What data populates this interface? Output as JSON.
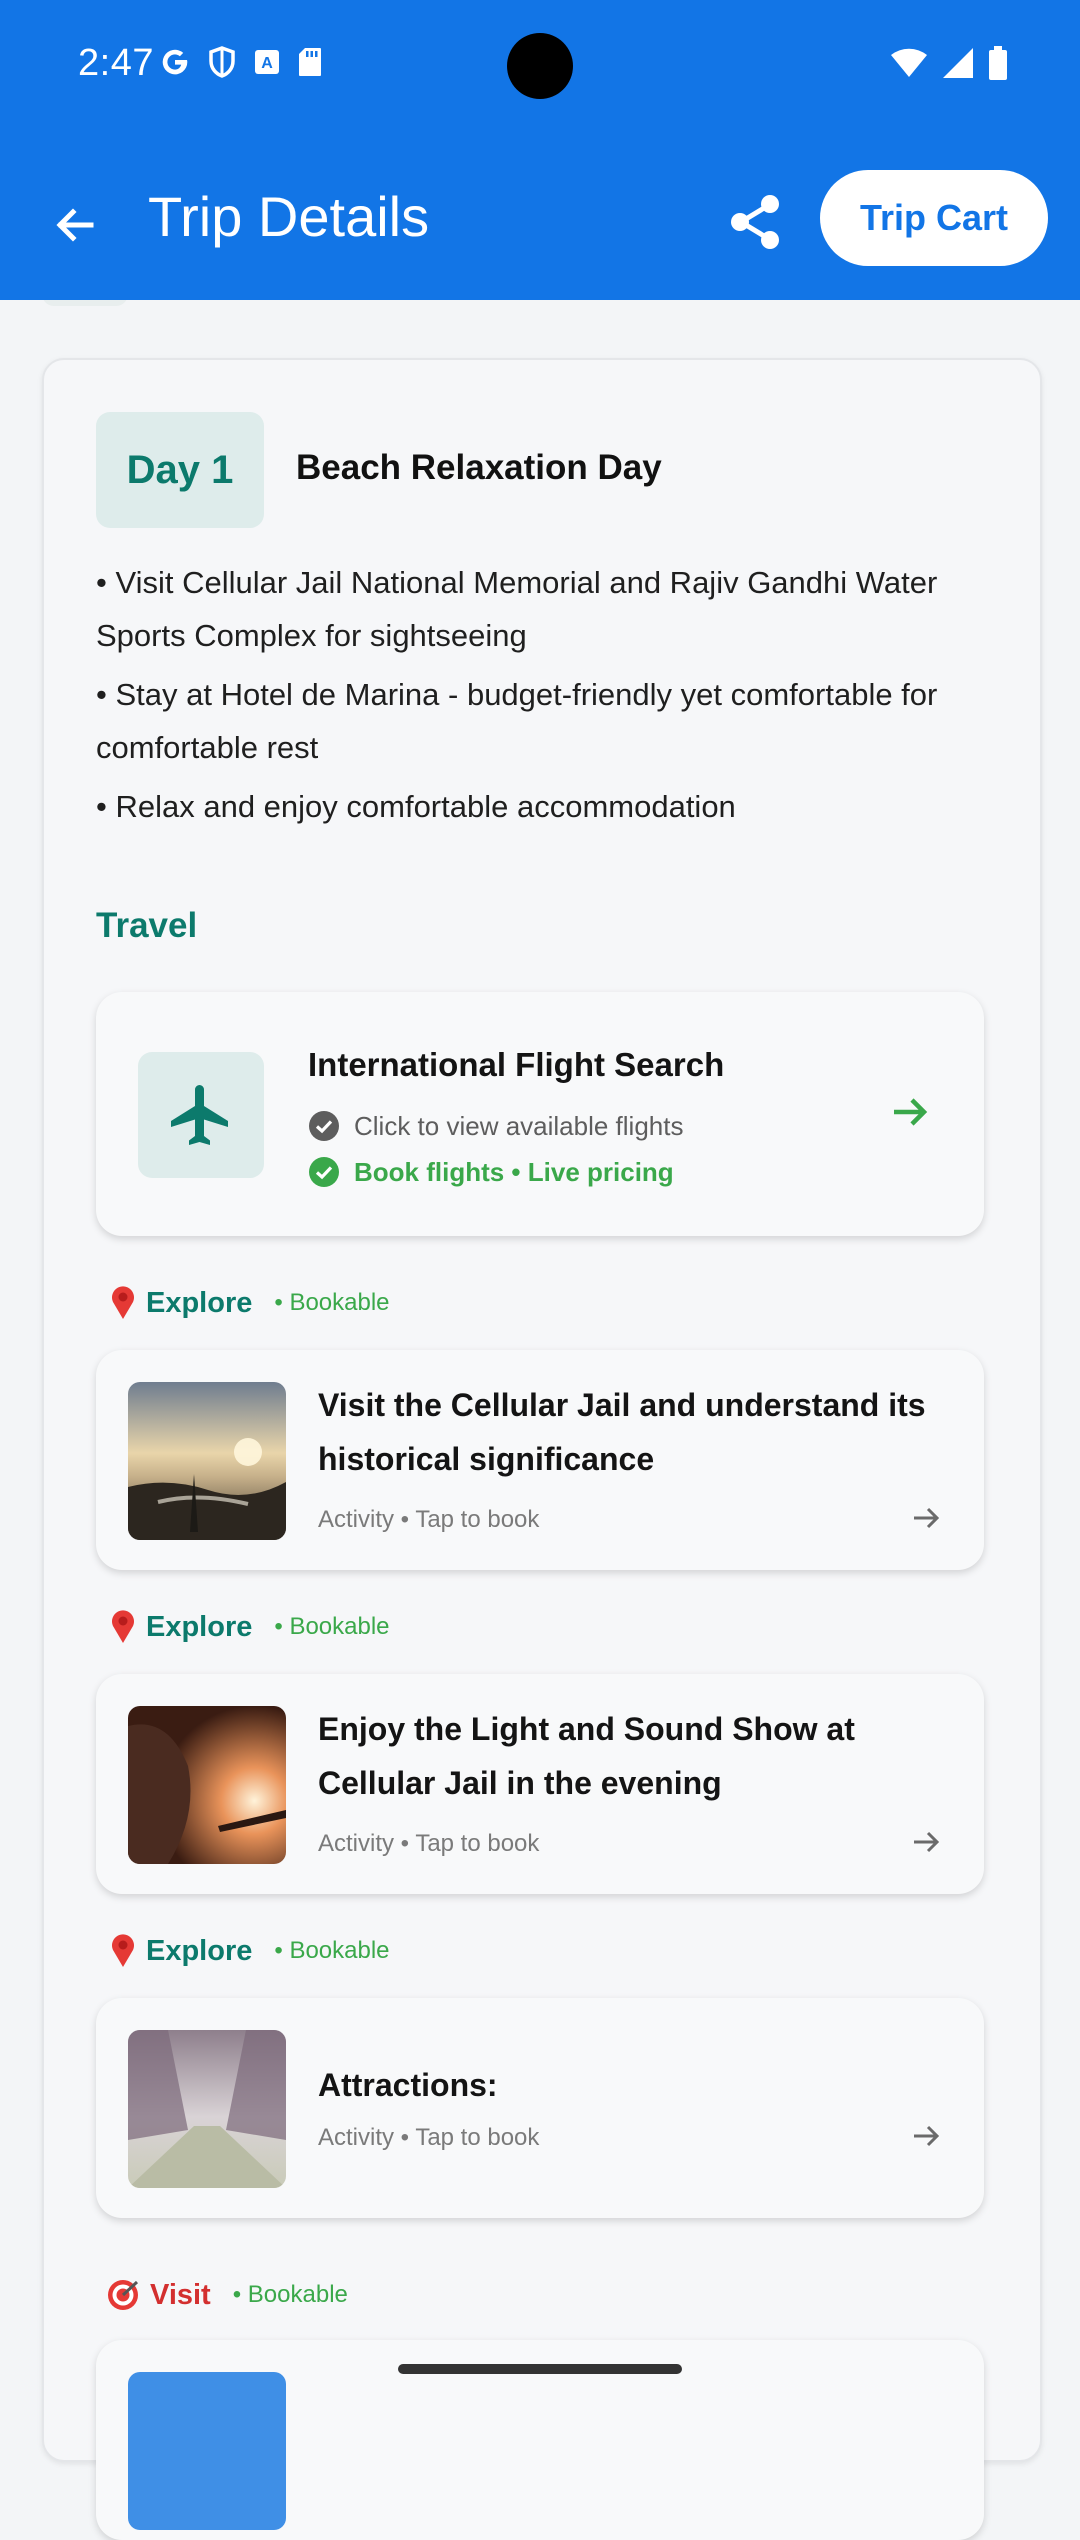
{
  "status_bar": {
    "time": "2:47"
  },
  "app_bar": {
    "title": "Trip Details",
    "cart_label": "Trip Cart",
    "bg_color": "#1275e6"
  },
  "day": {
    "badge": "Day 1",
    "title": "Beach Relaxation Day",
    "bullets": [
      "• Visit Cellular Jail National Memorial and Rajiv Gandhi Water Sports Complex for sightseeing",
      "• Stay at Hotel de Marina - budget-friendly yet comfortable for comfortable rest",
      "• Relax and enjoy comfortable accommodation"
    ]
  },
  "travel": {
    "label": "Travel",
    "flight": {
      "title": "International Flight Search",
      "subtitle": "Click to view available flights",
      "highlight": "Book flights • Live pricing",
      "icon": "airplane-icon"
    }
  },
  "sections": [
    {
      "icon": "pin-icon",
      "name": "Explore",
      "tag": "• Bookable",
      "title": "Visit the Cellular Jail and understand its historical significance",
      "subtitle": "Activity • Tap to book"
    },
    {
      "icon": "pin-icon",
      "name": "Explore",
      "tag": "• Bookable",
      "title": "Enjoy the Light and Sound Show at Cellular Jail in the evening",
      "subtitle": "Activity • Tap to book"
    },
    {
      "icon": "pin-icon",
      "name": "Explore",
      "tag": "• Bookable",
      "title": "Attractions:",
      "subtitle": "Activity • Tap to book"
    },
    {
      "icon": "target-icon",
      "name": "Visit",
      "tag": "• Bookable"
    }
  ],
  "colors": {
    "teal": "#0c7a6c",
    "green": "#3aa84a",
    "red": "#d32f2f"
  }
}
